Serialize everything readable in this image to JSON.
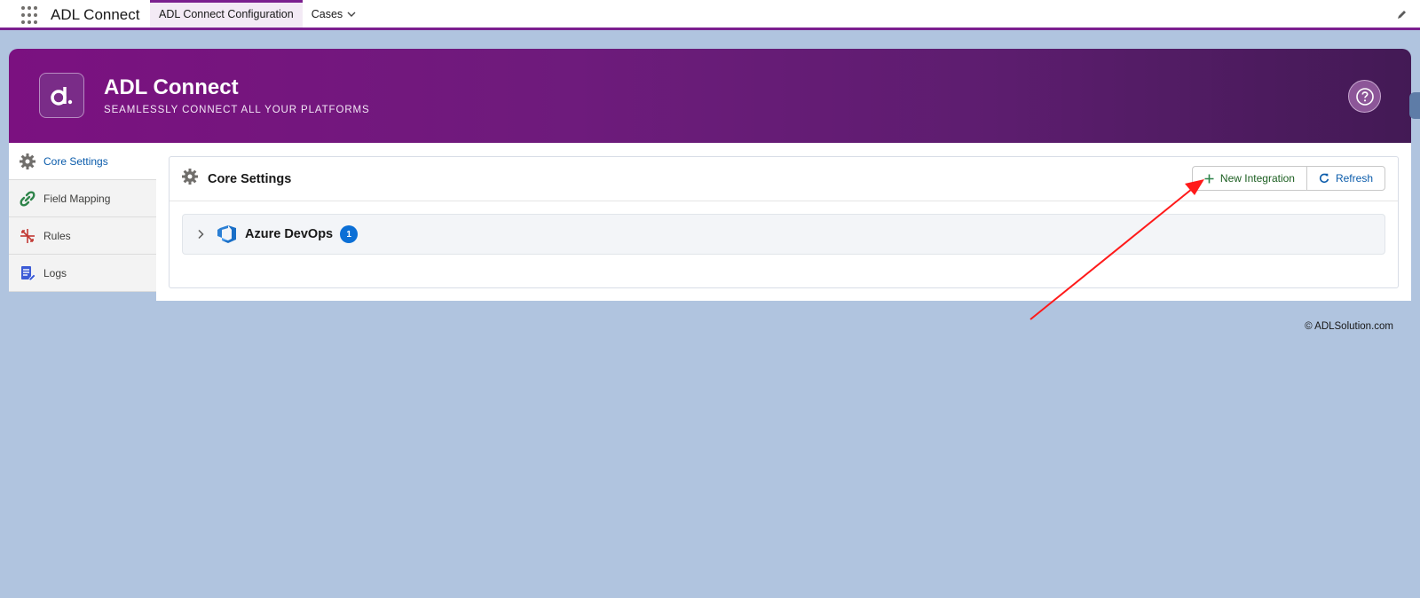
{
  "topbar": {
    "app_name": "ADL Connect",
    "tabs": [
      {
        "label": "ADL Connect Configuration",
        "active": true
      },
      {
        "label": "Cases",
        "active": false
      }
    ]
  },
  "banner": {
    "title": "ADL Connect",
    "subtitle": "SEAMLESSLY CONNECT ALL YOUR PLATFORMS"
  },
  "sidebar": {
    "items": [
      {
        "label": "Core Settings",
        "icon": "gear-icon",
        "active": true
      },
      {
        "label": "Field Mapping",
        "icon": "link-icon",
        "active": false
      },
      {
        "label": "Rules",
        "icon": "rules-icon",
        "active": false
      },
      {
        "label": "Logs",
        "icon": "logs-icon",
        "active": false
      }
    ]
  },
  "main": {
    "title": "Core Settings",
    "new_button": "New Integration",
    "refresh_button": "Refresh",
    "integrations": [
      {
        "name": "Azure DevOps",
        "count": "1"
      }
    ]
  },
  "footer": {
    "copyright": "© ADLSolution.com"
  },
  "colors": {
    "brand_purple": "#7b1180",
    "page_background": "#b0c4df",
    "link_blue": "#0b5cab",
    "badge_blue": "#0b6fd6",
    "annotation_red": "#ff1a1a"
  }
}
